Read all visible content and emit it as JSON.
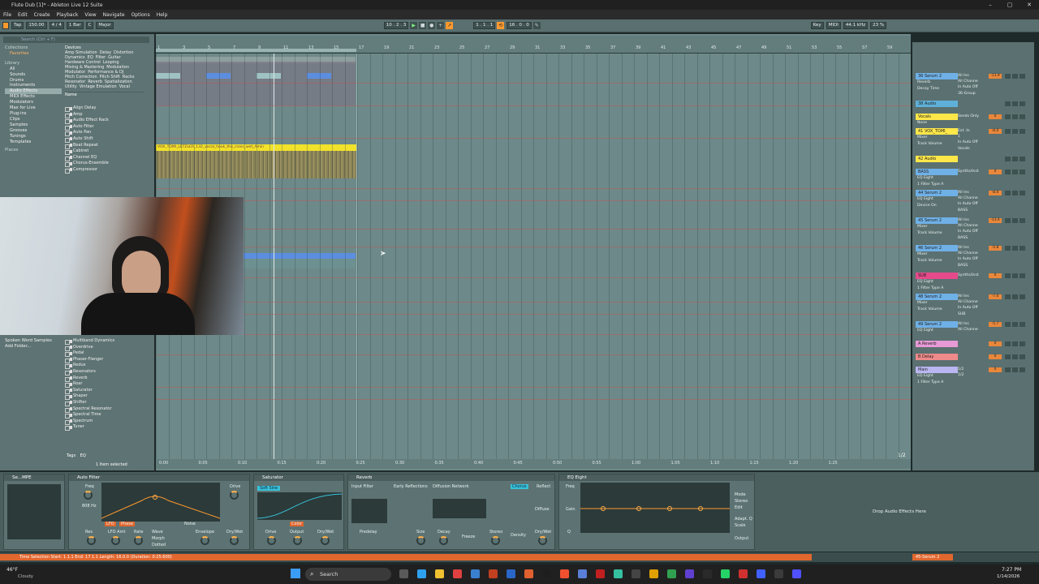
{
  "window": {
    "title": "Flute Dub [1]* - Ableton Live 12 Suite"
  },
  "menu": [
    "File",
    "Edit",
    "Create",
    "Playback",
    "View",
    "Navigate",
    "Options",
    "Help"
  ],
  "transport": {
    "tap": "Tap",
    "tempo": "150.00",
    "time_sig": "4 / 4",
    "quantize": "1 Bar",
    "key": "C",
    "scale": "Major",
    "position": "10 . 2 . 3",
    "loop_start": "1 . 1 . 1",
    "loop_length": "16 . 0 . 0",
    "midi": "MIDI",
    "sample_rate": "44.1 kHz",
    "cpu": "23 %",
    "key_label": "Key"
  },
  "browser": {
    "search_placeholder": "Search (Ctrl + F)",
    "collections_header": "Collections",
    "favorites": "Favorites",
    "library_header": "Library",
    "library_items": [
      "All",
      "Sounds",
      "Drums",
      "Instruments",
      "Audio Effects",
      "MIDI Effects",
      "Modulators",
      "Max for Live",
      "Plug-ins",
      "Clips",
      "Samples",
      "Grooves",
      "Tunings",
      "Templates"
    ],
    "places_header": "Places",
    "places_items": [
      "Spoken Word Samples",
      "Add Folder..."
    ],
    "devices_header": "Devices",
    "tags": [
      "Amp Simulation",
      "Delay",
      "Distortion",
      "Dynamics",
      "EQ",
      "Filter",
      "Guitar",
      "Hardware Control",
      "Looping",
      "Mixing & Mastering",
      "Modulation",
      "Modulator",
      "Performance & DJ",
      "Pitch Correction",
      "Pitch Shift",
      "Racks",
      "Resonator",
      "Reverb",
      "Spatialization",
      "Utility",
      "Vintage Emulation",
      "Vocal"
    ],
    "name_header": "Name",
    "list_top": [
      "Align Delay",
      "Amp",
      "Audio Effect Rack",
      "Auto Filter",
      "Auto Pan",
      "Auto Shift",
      "Beat Repeat",
      "Cabinet",
      "Channel EQ",
      "Chorus-Ensemble",
      "Compressor"
    ],
    "list_bottom": [
      "Multiband Dynamics",
      "Overdrive",
      "Pedal",
      "Phaser-Flanger",
      "Redux",
      "Resonators",
      "Reverb",
      "Roar",
      "Saturator",
      "Shaper",
      "Shifter",
      "Spectral Resonator",
      "Spectral Time",
      "Spectrum",
      "Tuner"
    ],
    "tags_label": "Tags",
    "tags_value": "EQ",
    "selected_info": "1 Item selected"
  },
  "ruler": {
    "bars": [
      "1",
      "3",
      "5",
      "7",
      "9",
      "11",
      "13",
      "15",
      "17",
      "19",
      "21",
      "23",
      "25",
      "27",
      "29",
      "31",
      "33",
      "35",
      "37",
      "39",
      "41",
      "43",
      "45",
      "47",
      "49",
      "51",
      "53",
      "55",
      "57",
      "59",
      "61",
      "63"
    ],
    "times": [
      "0:00",
      "0:05",
      "0:10",
      "0:15",
      "0:20",
      "0:25",
      "0:30",
      "0:35",
      "0:40",
      "0:45",
      "0:50",
      "0:55",
      "1:00",
      "1:05",
      "1:10",
      "1:15",
      "1:20",
      "1:25"
    ],
    "page": "1/2"
  },
  "clips": {
    "vocal_name": "VOX_TOMI_LETZLER_132_vocal_hook_the_cross_wet_Amin"
  },
  "mixer": {
    "tracks": [
      {
        "name": "36 Serum 2",
        "color": "#6fb0e6",
        "sub": [
          "Reverb",
          "Decay Time"
        ],
        "route": [
          "All Ins",
          "All Channe",
          "In Auto Off"
        ],
        "vol": "-11.9",
        "group": "36-Group"
      },
      {
        "name": "38 Audio",
        "color": "#5fb0d8",
        "sub": [],
        "route": [],
        "vol": "",
        "group": ""
      },
      {
        "name": "Vocals",
        "color": "#ffe74a",
        "sub": [
          "None"
        ],
        "route": [
          "Sends Only"
        ],
        "vol": "0",
        "group": ""
      },
      {
        "name": "41 VOX_TOMI_",
        "color": "#ffe74a",
        "sub": [
          "Mixer",
          "Track Volume"
        ],
        "route": [
          "Ext. In",
          "1",
          "In Auto Off"
        ],
        "vol": "-8.0",
        "group": "Vocals"
      },
      {
        "name": "42 Audio",
        "color": "#ffe74a",
        "sub": [],
        "route": [],
        "vol": "",
        "group": ""
      },
      {
        "name": "BASS",
        "color": "#6fb0e6",
        "sub": [
          "EQ Eight",
          "1 Filter Type A"
        ],
        "route": [
          "Synths/Inst"
        ],
        "vol": "0",
        "group": ""
      },
      {
        "name": "44 Serum 2",
        "color": "#6fb0e6",
        "sub": [
          "EQ Eight",
          "Device On"
        ],
        "route": [
          "All Ins",
          "All Channe",
          "In Auto Off"
        ],
        "vol": "-8.0",
        "group": "BASS"
      },
      {
        "name": "45 Serum 2",
        "color": "#6fb0e6",
        "sub": [
          "Mixer",
          "Track Volume"
        ],
        "route": [
          "All Ins",
          "All Channe",
          "In Auto Off"
        ],
        "vol": "-13.4",
        "group": "BASS"
      },
      {
        "name": "46 Serum 2",
        "color": "#6fb0e6",
        "sub": [
          "Mixer",
          "Track Volume"
        ],
        "route": [
          "All Ins",
          "All Channe",
          "In Auto Off"
        ],
        "vol": "-5.8",
        "group": "BASS"
      },
      {
        "name": "SUB",
        "color": "#e64a8a",
        "sub": [
          "EQ Eight",
          "1 Filter Type A"
        ],
        "route": [
          "Synths/Inst"
        ],
        "vol": "0",
        "group": ""
      },
      {
        "name": "48 Serum 2",
        "color": "#6fb0e6",
        "sub": [
          "Mixer",
          "Track Volume"
        ],
        "route": [
          "All Ins",
          "All Channe",
          "In Auto Off"
        ],
        "vol": "-7.0",
        "group": "SUB"
      },
      {
        "name": "49 Serum 2",
        "color": "#6fb0e6",
        "sub": [
          "EQ Eight"
        ],
        "route": [
          "All Ins",
          "All Channe"
        ],
        "vol": "-5.7",
        "group": ""
      },
      {
        "name": "A Reverb",
        "color": "#e79ad6",
        "sub": [],
        "route": [],
        "vol": "0",
        "group": ""
      },
      {
        "name": "B Delay",
        "color": "#ef8a8a",
        "sub": [],
        "route": [],
        "vol": "0",
        "group": ""
      },
      {
        "name": "Main",
        "color": "#b9b6f2",
        "sub": [
          "EQ Eight",
          "1 Filter Type A"
        ],
        "route": [
          "1/2",
          "1/2"
        ],
        "vol": "0",
        "group": ""
      }
    ]
  },
  "devices": {
    "auto_filter": {
      "title": "Auto Filter",
      "freq": "Freq",
      "freq_val": "808 Hz",
      "res": "Res",
      "lfo": "LFO",
      "lfo_amt": "LFO Amt",
      "rate": "Rate",
      "wave": "Wave",
      "morph": "Morph",
      "envelope": "Envelope",
      "drive": "Drive",
      "drywet": "Dry/Wet",
      "phase": "Phase",
      "noise": "Noise",
      "dotted": "Dotted"
    },
    "saturator": {
      "title": "Saturator",
      "mode": "Soft Sine",
      "drive": "Drive",
      "output": "Output",
      "drywet": "Dry/Wet",
      "color": "Color"
    },
    "reverb": {
      "title": "Reverb",
      "input_filter": "Input Filter",
      "early": "Early Reflections",
      "diffusion": "Diffusion Network",
      "predelay": "Predelay",
      "size": "Size",
      "decay": "Decay",
      "freeze": "Freeze",
      "stereo": "Stereo",
      "density": "Density",
      "drywet": "Dry/Wet",
      "chorus": "Chorus",
      "reflect": "Reflect",
      "diffuse": "Diffuse"
    },
    "eq_eight": {
      "title": "EQ Eight",
      "freq": "Freq",
      "gain": "Gain",
      "q": "Q",
      "mode": "Mode",
      "stereo": "Stereo",
      "edit": "Edit",
      "scale": "Scale",
      "adapt_q": "Adapt. Q",
      "output": "Output"
    },
    "drop_hint": "Drop Audio Effects Here",
    "serum_label": "Se...MPE"
  },
  "status": {
    "message": "Time Selection  Start: 1.1.1   End: 17.1.1   Length: 16.0.0 (Duration: 0:25:600)",
    "track": "45-Serum 2"
  },
  "taskbar": {
    "weather_temp": "46°F",
    "weather_desc": "Cloudy",
    "search": "Search",
    "time": "7:27 PM",
    "date": "1/14/2026"
  }
}
